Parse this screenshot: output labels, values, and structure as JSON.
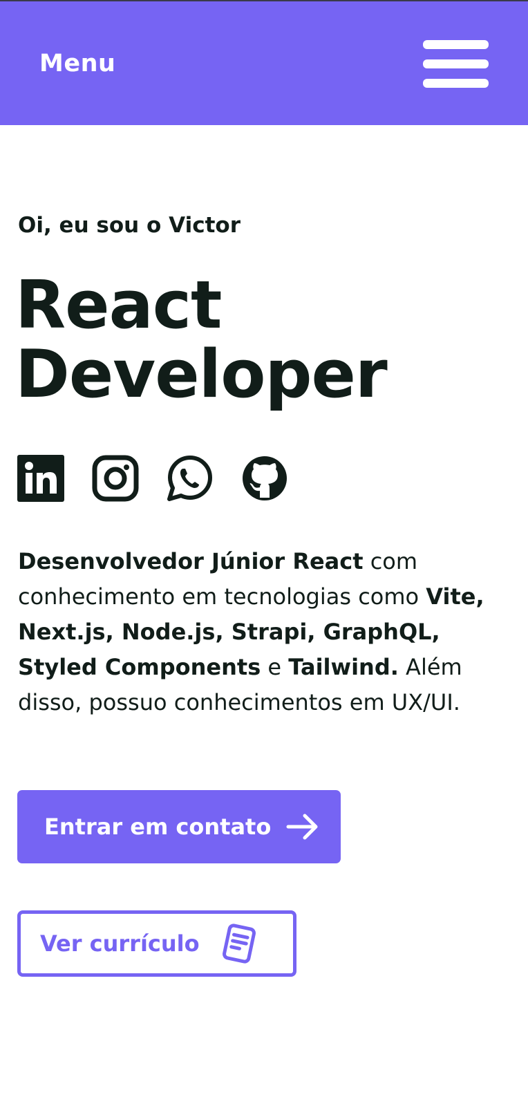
{
  "header": {
    "menu_label": "Menu",
    "hamburger_icon": "hamburger-menu-icon",
    "background_color": "#7664f3"
  },
  "hero": {
    "greeting_prefix": "Oi, eu sou o ",
    "greeting_name": "Victor",
    "title_line1": "React",
    "title_line2": "Developer"
  },
  "socials": [
    {
      "name": "linkedin-icon"
    },
    {
      "name": "instagram-icon"
    },
    {
      "name": "whatsapp-icon"
    },
    {
      "name": "github-icon"
    }
  ],
  "bio": {
    "p1_bold": "Desenvolvedor Júnior React",
    "p2": " com conhecimento em tecnologias como ",
    "p3_bold": "Vite, Next.js, Node.js, Strapi, GraphQL, Styled Components",
    "p4": " e ",
    "p5_bold": "Tailwind.",
    "p6": " Além disso, possuo conhecimentos em UX/UI."
  },
  "buttons": {
    "contact_label": "Entrar em contato",
    "contact_icon": "arrow-right-icon",
    "resume_label": "Ver currículo",
    "resume_icon": "document-icon"
  },
  "colors": {
    "accent": "#7664f3",
    "text": "#111d19",
    "background": "#ffffff"
  }
}
